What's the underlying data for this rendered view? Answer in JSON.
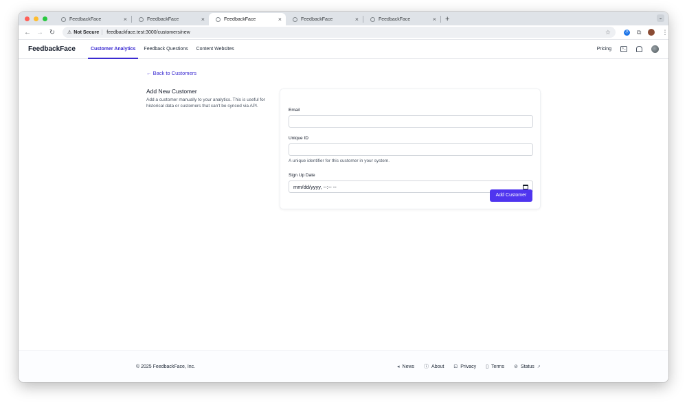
{
  "browser": {
    "tabs": [
      {
        "title": "FeedbackFace",
        "active": false
      },
      {
        "title": "FeedbackFace",
        "active": false
      },
      {
        "title": "FeedbackFace",
        "active": true
      },
      {
        "title": "FeedbackFace",
        "active": false
      },
      {
        "title": "FeedbackFace",
        "active": false
      }
    ],
    "security_label": "Not Secure",
    "url": "feedbackface.test:3000/customers/new"
  },
  "header": {
    "logo": "FeedbackFace",
    "nav": [
      "Customer Analytics",
      "Feedback Questions",
      "Content Websites"
    ],
    "active_nav": "Customer Analytics",
    "pricing": "Pricing"
  },
  "main": {
    "back_link": "← Back to Customers",
    "title": "Add New Customer",
    "description": "Add a customer manually to your analytics. This is useful for historical data or customers that can't be synced via API.",
    "form": {
      "email_label": "Email",
      "email_value": "",
      "unique_id_label": "Unique ID",
      "unique_id_value": "",
      "unique_id_help": "A unique identifier for this customer in your system.",
      "signup_label": "Sign Up Date",
      "signup_placeholder": "mm/dd/yyyy, --:-- --",
      "submit_label": "Add Customer"
    }
  },
  "footer": {
    "copyright": "© 2025 FeedbackFace, Inc.",
    "links": [
      "News",
      "About",
      "Privacy",
      "Terms",
      "Status"
    ]
  },
  "colors": {
    "accent": "#3a2ad1",
    "button": "#4f35ef"
  }
}
